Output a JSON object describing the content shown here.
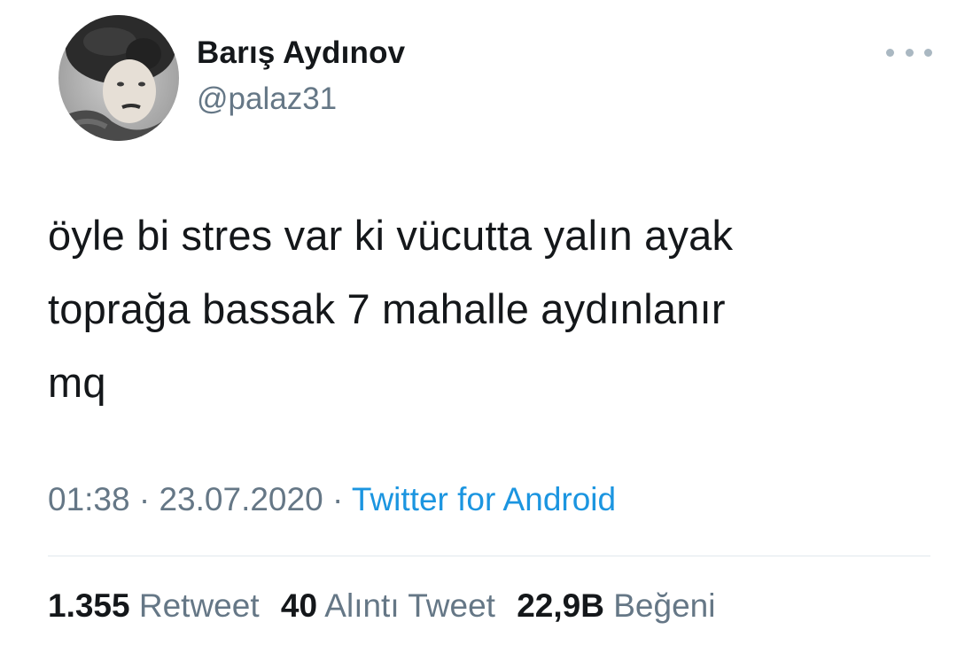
{
  "user": {
    "display_name": "Barış Aydınov",
    "handle": "@palaz31",
    "avatar": "profile-photo-avatar"
  },
  "menu": {
    "icon": "more-options-icon"
  },
  "tweet": {
    "text": "öyle bi stres var ki vücutta yalın ayak\ntoprağa bassak 7 mahalle aydınlanır\nmq"
  },
  "meta": {
    "time": "01:38",
    "separator": "·",
    "date": "23.07.2020",
    "source": "Twitter for Android"
  },
  "stats": {
    "retweets": {
      "count": "1.355",
      "label": "Retweet"
    },
    "quotes": {
      "count": "40",
      "label": "Alıntı Tweet"
    },
    "likes": {
      "count": "22,9B",
      "label": "Beğeni"
    }
  },
  "colors": {
    "text_primary": "#14171a",
    "text_secondary": "#657786",
    "link": "#1b95e0",
    "divider": "#e1e8ed"
  }
}
